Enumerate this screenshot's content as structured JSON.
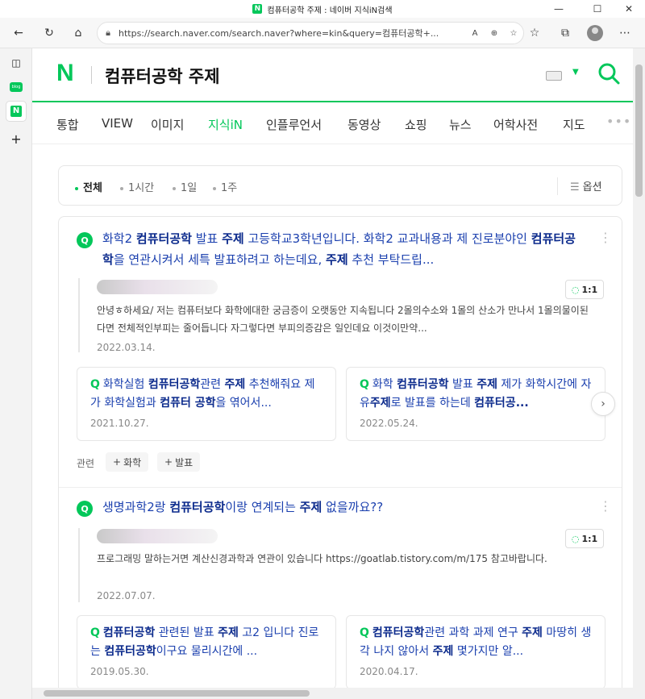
{
  "window": {
    "title": "컴퓨터공학 주제 : 네이버 지식iN검색",
    "tab_icon": "N"
  },
  "browser": {
    "url": "https://search.naver.com/search.naver?where=kin&query=컴퓨터공학+...",
    "read_aloud": "A",
    "sidebar_app": "N",
    "sidebar_blog": "blog"
  },
  "naver": {
    "logo": "N",
    "query": "컴퓨터공학 주제",
    "brand_color": "#03c75a"
  },
  "tabs": [
    "통합",
    "VIEW",
    "이미지",
    "지식iN",
    "인플루언서",
    "동영상",
    "쇼핑",
    "뉴스",
    "어학사전",
    "지도"
  ],
  "active_tab": "지식iN",
  "filters": [
    "전체",
    "1시간",
    "1일",
    "1주"
  ],
  "option_label": "옵션",
  "results": [
    {
      "title_parts": [
        {
          "t": "화학2 ",
          "b": false
        },
        {
          "t": "컴퓨터공학",
          "b": true
        },
        {
          "t": " 발표 ",
          "b": false
        },
        {
          "t": "주제",
          "b": true
        },
        {
          "t": " 고등학교3학년입니다. 화학2 교과내용과 제 진로분야인 ",
          "b": false
        },
        {
          "t": "컴퓨터공학",
          "b": true
        },
        {
          "t": "을 연관시켜서 세특 발표하려고 하는데요, ",
          "b": false
        },
        {
          "t": "주제",
          "b": true
        },
        {
          "t": " 추천 부탁드립...",
          "b": false
        }
      ],
      "answer_badge": "1:1",
      "answer": "안녕ㅎ하세요/ 저는 컴퓨터보다 화학에대한 궁금증이 오랫동안 지속됩니다 2몰의수소와 1몰의 산소가 만나서 1몰의물이된다면 전체적인부피는 줄어듭니다 자그렇다면 부피의증감은 일인데요 이것이만약...",
      "date": "2022.03.14.",
      "related": [
        {
          "parts": [
            {
              "t": "화학실험 ",
              "b": false
            },
            {
              "t": "컴퓨터공학",
              "b": true
            },
            {
              "t": "관련 ",
              "b": false
            },
            {
              "t": "주제",
              "b": true
            },
            {
              "t": " 추천해줘요 제가 화학실험과 ",
              "b": false
            },
            {
              "t": "컴퓨터 공학",
              "b": true
            },
            {
              "t": "을 엮어서...",
              "b": false
            }
          ],
          "date": "2021.10.27."
        },
        {
          "parts": [
            {
              "t": "화학 ",
              "b": false
            },
            {
              "t": "컴퓨터공학",
              "b": true
            },
            {
              "t": " 발표 ",
              "b": false
            },
            {
              "t": "주제",
              "b": true
            },
            {
              "t": " 제가 화학시간에 자유",
              "b": false
            },
            {
              "t": "주제",
              "b": true
            },
            {
              "t": "로 발표를 하는데 ",
              "b": false
            },
            {
              "t": "컴퓨터공...",
              "b": true
            }
          ],
          "date": "2022.05.24."
        }
      ],
      "tags_label": "관련",
      "tags": [
        "화학",
        "발표"
      ]
    },
    {
      "title_parts": [
        {
          "t": "생명과학2랑 ",
          "b": false
        },
        {
          "t": "컴퓨터공학",
          "b": true
        },
        {
          "t": "이랑 연계되는 ",
          "b": false
        },
        {
          "t": "주제",
          "b": true
        },
        {
          "t": " 없을까요??",
          "b": false
        }
      ],
      "answer_badge": "1:1",
      "answer": "프로그래밍 말하는거면 계산신경과학과 연관이 있습니다 https://goatlab.tistory.com/m/175 참고바랍니다.",
      "date": "2022.07.07.",
      "related": [
        {
          "parts": [
            {
              "t": "컴퓨터공학",
              "b": true
            },
            {
              "t": " 관련된 발표 ",
              "b": false
            },
            {
              "t": "주제",
              "b": true
            },
            {
              "t": " 고2 입니다 진로는 ",
              "b": false
            },
            {
              "t": "컴퓨터공학",
              "b": true
            },
            {
              "t": "이구요 물리시간에 ...",
              "b": false
            }
          ],
          "date": "2019.05.30."
        },
        {
          "parts": [
            {
              "t": "컴퓨터공학",
              "b": true
            },
            {
              "t": "관련 과학 과제 연구 ",
              "b": false
            },
            {
              "t": "주제",
              "b": true
            },
            {
              "t": " 마땅히 생각 나지 않아서 ",
              "b": false
            },
            {
              "t": "주제",
              "b": true
            },
            {
              "t": " 몇가지만 알...",
              "b": false
            }
          ],
          "date": "2020.04.17."
        }
      ]
    }
  ]
}
